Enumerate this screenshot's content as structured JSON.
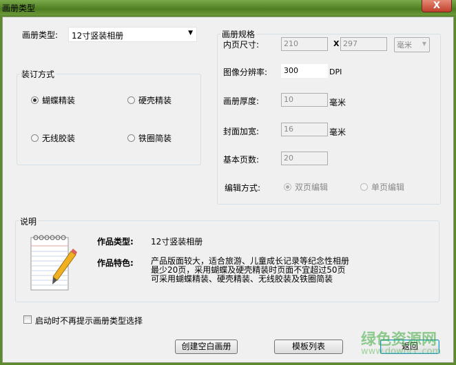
{
  "window": {
    "title": "画册类型",
    "close": "X"
  },
  "album_type": {
    "label": "画册类型:",
    "value": "12寸竖装相册"
  },
  "binding": {
    "title": "装订方式",
    "options": [
      {
        "label": "蝴蝶精装",
        "checked": true
      },
      {
        "label": "硬壳精装",
        "checked": false
      },
      {
        "label": "无线胶装",
        "checked": false
      },
      {
        "label": "铁圈简装",
        "checked": false
      }
    ]
  },
  "spec": {
    "title": "画册规格",
    "page_size": {
      "label": "内页尺寸:",
      "width": "210",
      "x": "X",
      "height": "297",
      "unit": "毫米"
    },
    "resolution": {
      "label": "图像分辨率:",
      "value": "300",
      "unit": "DPI"
    },
    "thickness": {
      "label": "画册厚度:",
      "value": "10",
      "unit": "毫米"
    },
    "cover_widen": {
      "label": "封面加宽:",
      "value": "16",
      "unit": "毫米"
    },
    "base_pages": {
      "label": "基本页数:",
      "value": "20"
    },
    "edit_mode": {
      "label": "编辑方式:",
      "options": [
        {
          "label": "双页编辑",
          "checked": true
        },
        {
          "label": "单页编辑",
          "checked": false
        }
      ]
    }
  },
  "description": {
    "title": "说明",
    "type_label": "作品类型:",
    "type_value": "12寸竖装相册",
    "feature_label": "作品特色:",
    "feature_lines": [
      "产品版面较大，适合旅游、儿童成长记录等纪念性相册",
      "最少20页，采用蝴蝶及硬壳精装时页面不宜超过50页",
      "可采用蝴蝶精装、硬壳精装、无线胶装及铁圈简装"
    ]
  },
  "startup_checkbox": {
    "label": "启动时不再提示画册类型选择",
    "checked": false
  },
  "buttons": {
    "create_blank": "创建空白画册",
    "template_list": "模板列表",
    "back": "返回"
  },
  "watermark": {
    "text": "绿色资源网",
    "url": "www.downcc.com"
  }
}
